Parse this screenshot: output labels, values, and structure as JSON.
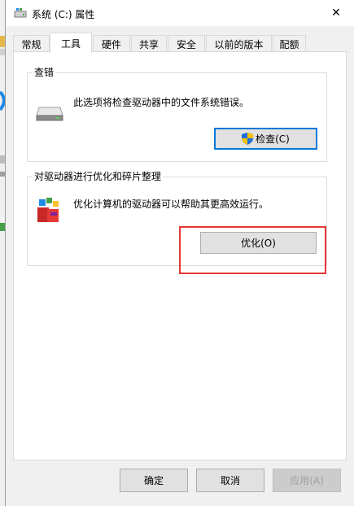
{
  "window": {
    "title": "系统 (C:) 属性",
    "close_symbol": "✕"
  },
  "tabs": [
    {
      "label": "常规",
      "active": false
    },
    {
      "label": "工具",
      "active": true
    },
    {
      "label": "硬件",
      "active": false
    },
    {
      "label": "共享",
      "active": false
    },
    {
      "label": "安全",
      "active": false
    },
    {
      "label": "以前的版本",
      "active": false
    },
    {
      "label": "配额",
      "active": false
    }
  ],
  "check_group": {
    "title": "查错",
    "description": "此选项将检查驱动器中的文件系统错误。",
    "button_label": "检查(C)",
    "icon": "drive-icon"
  },
  "optimize_group": {
    "title": "对驱动器进行优化和碎片整理",
    "description": "优化计算机的驱动器可以帮助其更高效运行。",
    "button_label": "优化(O)",
    "icon": "defrag-icon"
  },
  "footer": {
    "ok_label": "确定",
    "cancel_label": "取消",
    "apply_label": "应用(A)"
  },
  "colors": {
    "highlight": "#e53935",
    "focus": "#0078d7"
  }
}
